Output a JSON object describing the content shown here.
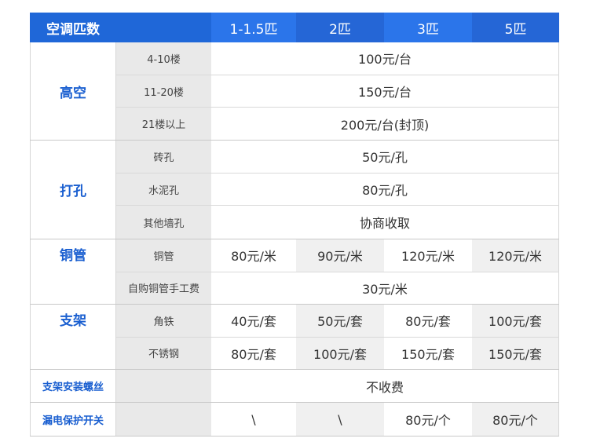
{
  "header": {
    "c1": "空调匹数",
    "c2": "",
    "c3": "1-1.5匹",
    "c4": "2匹",
    "c5": "3匹",
    "c6": "5匹"
  },
  "gaokong": {
    "name": "高空",
    "rows": [
      {
        "label": "4-10楼",
        "value": "100元/台"
      },
      {
        "label": "11-20楼",
        "value": "150元/台"
      },
      {
        "label": "21楼以上",
        "value": "200元/台(封顶)"
      }
    ]
  },
  "dakong": {
    "name": "打孔",
    "rows": [
      {
        "label": "砖孔",
        "value": "50元/孔"
      },
      {
        "label": "水泥孔",
        "value": "80元/孔"
      },
      {
        "label": "其他墙孔",
        "value": "协商收取"
      }
    ]
  },
  "tongguan": {
    "name": "铜管",
    "row1": {
      "label": "铜管",
      "v1": "80元/米",
      "v2": "90元/米",
      "v3": "120元/米",
      "v4": "120元/米"
    },
    "row2": {
      "label": "自购铜管手工费",
      "value": "30元/米"
    }
  },
  "zhijia": {
    "name": "支架",
    "row1": {
      "label": "角铁",
      "v1": "40元/套",
      "v2": "50元/套",
      "v3": "80元/套",
      "v4": "100元/套"
    },
    "row2": {
      "label": "不锈钢",
      "v1": "80元/套",
      "v2": "100元/套",
      "v3": "150元/套",
      "v4": "150元/套"
    }
  },
  "luosi": {
    "name": "支架安装螺丝",
    "value": "不收费"
  },
  "loudian": {
    "name": "漏电保护开关",
    "v1": "\\",
    "v2": "\\",
    "v3": "80元/个",
    "v4": "80元/个"
  }
}
